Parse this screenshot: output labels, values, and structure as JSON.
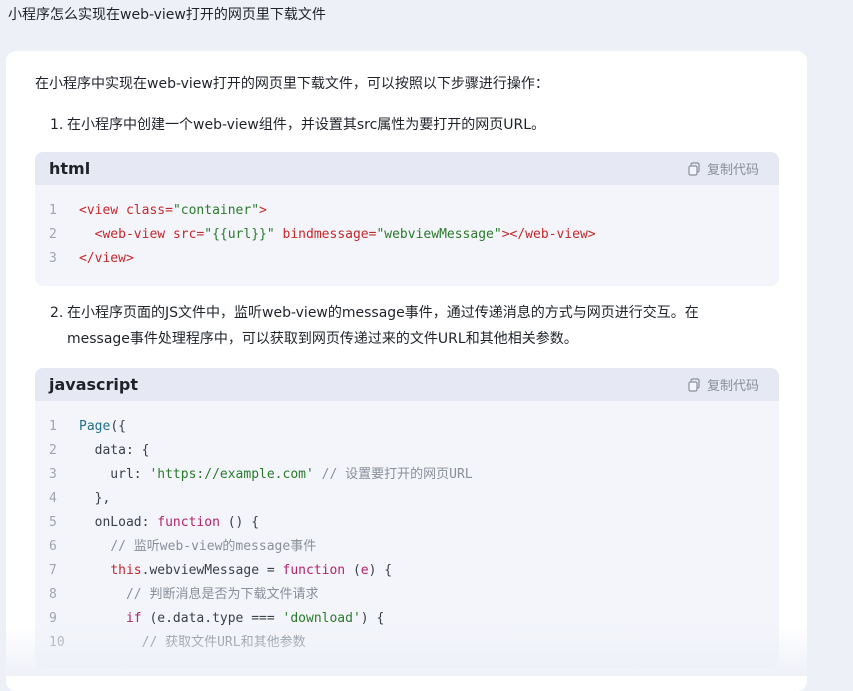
{
  "question": "小程序怎么实现在web-view打开的网页里下载文件",
  "answer": {
    "intro": "在小程序中实现在web-view打开的网页里下载文件，可以按照以下步骤进行操作：",
    "steps": [
      {
        "num": "1.",
        "text": "在小程序中创建一个web-view组件，并设置其src属性为要打开的网页URL。"
      },
      {
        "num": "2.",
        "text_line1": "在小程序页面的JS文件中，监听web-view的message事件，通过传递消息的方式与网页进行交互。在",
        "text_line2": "message事件处理程序中，可以获取到网页传递过来的文件URL和其他相关参数。"
      }
    ],
    "code_blocks": [
      {
        "lang": "html",
        "copy_label": "复制代码",
        "lines": [
          {
            "n": "1",
            "tokens": [
              [
                "tag",
                "<view "
              ],
              [
                "attr",
                "class="
              ],
              [
                "str",
                "\"container\""
              ],
              [
                "tag",
                ">"
              ]
            ]
          },
          {
            "n": "2",
            "tokens": [
              [
                "plain",
                "  "
              ],
              [
                "tag",
                "<web-view "
              ],
              [
                "attr",
                "src="
              ],
              [
                "str",
                "\"{{url}}\""
              ],
              [
                "plain",
                " "
              ],
              [
                "attr",
                "bindmessage="
              ],
              [
                "str",
                "\"webviewMessage\""
              ],
              [
                "tag",
                "></web-view>"
              ]
            ]
          },
          {
            "n": "3",
            "tokens": [
              [
                "tag",
                "</view>"
              ]
            ]
          }
        ]
      },
      {
        "lang": "javascript",
        "copy_label": "复制代码",
        "lines": [
          {
            "n": "1",
            "tokens": [
              [
                "fn",
                "Page"
              ],
              [
                "plain",
                "({"
              ]
            ]
          },
          {
            "n": "2",
            "tokens": [
              [
                "plain",
                "  data: {"
              ]
            ]
          },
          {
            "n": "3",
            "tokens": [
              [
                "plain",
                "    url: "
              ],
              [
                "str",
                "'https://example.com'"
              ],
              [
                "plain",
                " "
              ],
              [
                "comment",
                "// 设置要打开的网页URL"
              ]
            ]
          },
          {
            "n": "4",
            "tokens": [
              [
                "plain",
                "  },"
              ]
            ]
          },
          {
            "n": "5",
            "tokens": [
              [
                "plain",
                "  onLoad: "
              ],
              [
                "key",
                "function"
              ],
              [
                "plain",
                " () {"
              ]
            ]
          },
          {
            "n": "6",
            "tokens": [
              [
                "plain",
                "    "
              ],
              [
                "comment",
                "// 监听web-view的message事件"
              ]
            ]
          },
          {
            "n": "7",
            "tokens": [
              [
                "plain",
                "    "
              ],
              [
                "this",
                "this"
              ],
              [
                "plain",
                ".webviewMessage = "
              ],
              [
                "key",
                "function"
              ],
              [
                "plain",
                " ("
              ],
              [
                "param",
                "e"
              ],
              [
                "plain",
                ") {"
              ]
            ]
          },
          {
            "n": "8",
            "tokens": [
              [
                "plain",
                "      "
              ],
              [
                "comment",
                "// 判断消息是否为下载文件请求"
              ]
            ]
          },
          {
            "n": "9",
            "tokens": [
              [
                "plain",
                "      "
              ],
              [
                "key",
                "if"
              ],
              [
                "plain",
                " (e.data.type === "
              ],
              [
                "str",
                "'download'"
              ],
              [
                "plain",
                ") {"
              ]
            ]
          },
          {
            "n": "10",
            "tokens": [
              [
                "plain",
                "        "
              ],
              [
                "comment",
                "// 获取文件URL和其他参数"
              ]
            ]
          }
        ]
      }
    ]
  }
}
